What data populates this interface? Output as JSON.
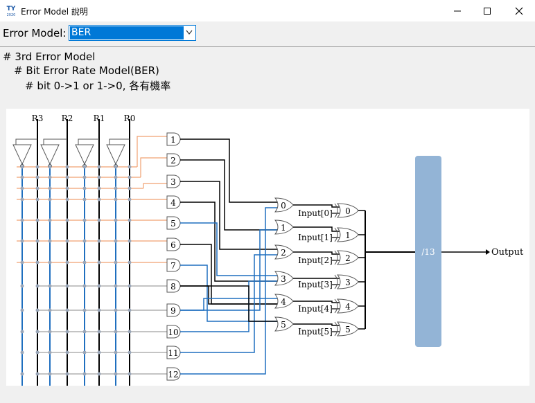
{
  "window": {
    "title": "Error Model 說明",
    "icon": "ty-app-icon",
    "icon_text": "TY",
    "icon_subtext": "2020"
  },
  "toolbar": {
    "label": "Error Model:",
    "select_value": "BER"
  },
  "description": {
    "lines": [
      "# 3rd Error Model",
      "# Bit Error Rate Model(BER)",
      "# bit 0->1 or 1->0, 各有機率"
    ]
  },
  "diagram": {
    "registers": [
      "R3",
      "R2",
      "R1",
      "R0"
    ],
    "and_gates": [
      "1",
      "2",
      "3",
      "4",
      "5",
      "6",
      "7",
      "8",
      "9",
      "10",
      "11",
      "12"
    ],
    "or_gates": [
      "0",
      "1",
      "2",
      "3",
      "4",
      "5"
    ],
    "input_labels": [
      "Input[0]",
      "Input[1]",
      "Input[2]",
      "Input[3]",
      "Input[4]",
      "Input[5]"
    ],
    "xor_gates": [
      "0",
      "1",
      "2",
      "3",
      "4",
      "5"
    ],
    "bus_label": "/13",
    "output_label": "Output",
    "colors": {
      "blue": "#1f6fbf",
      "orange": "#f0a070",
      "bus": "#93b4d6",
      "black": "#000000"
    }
  }
}
